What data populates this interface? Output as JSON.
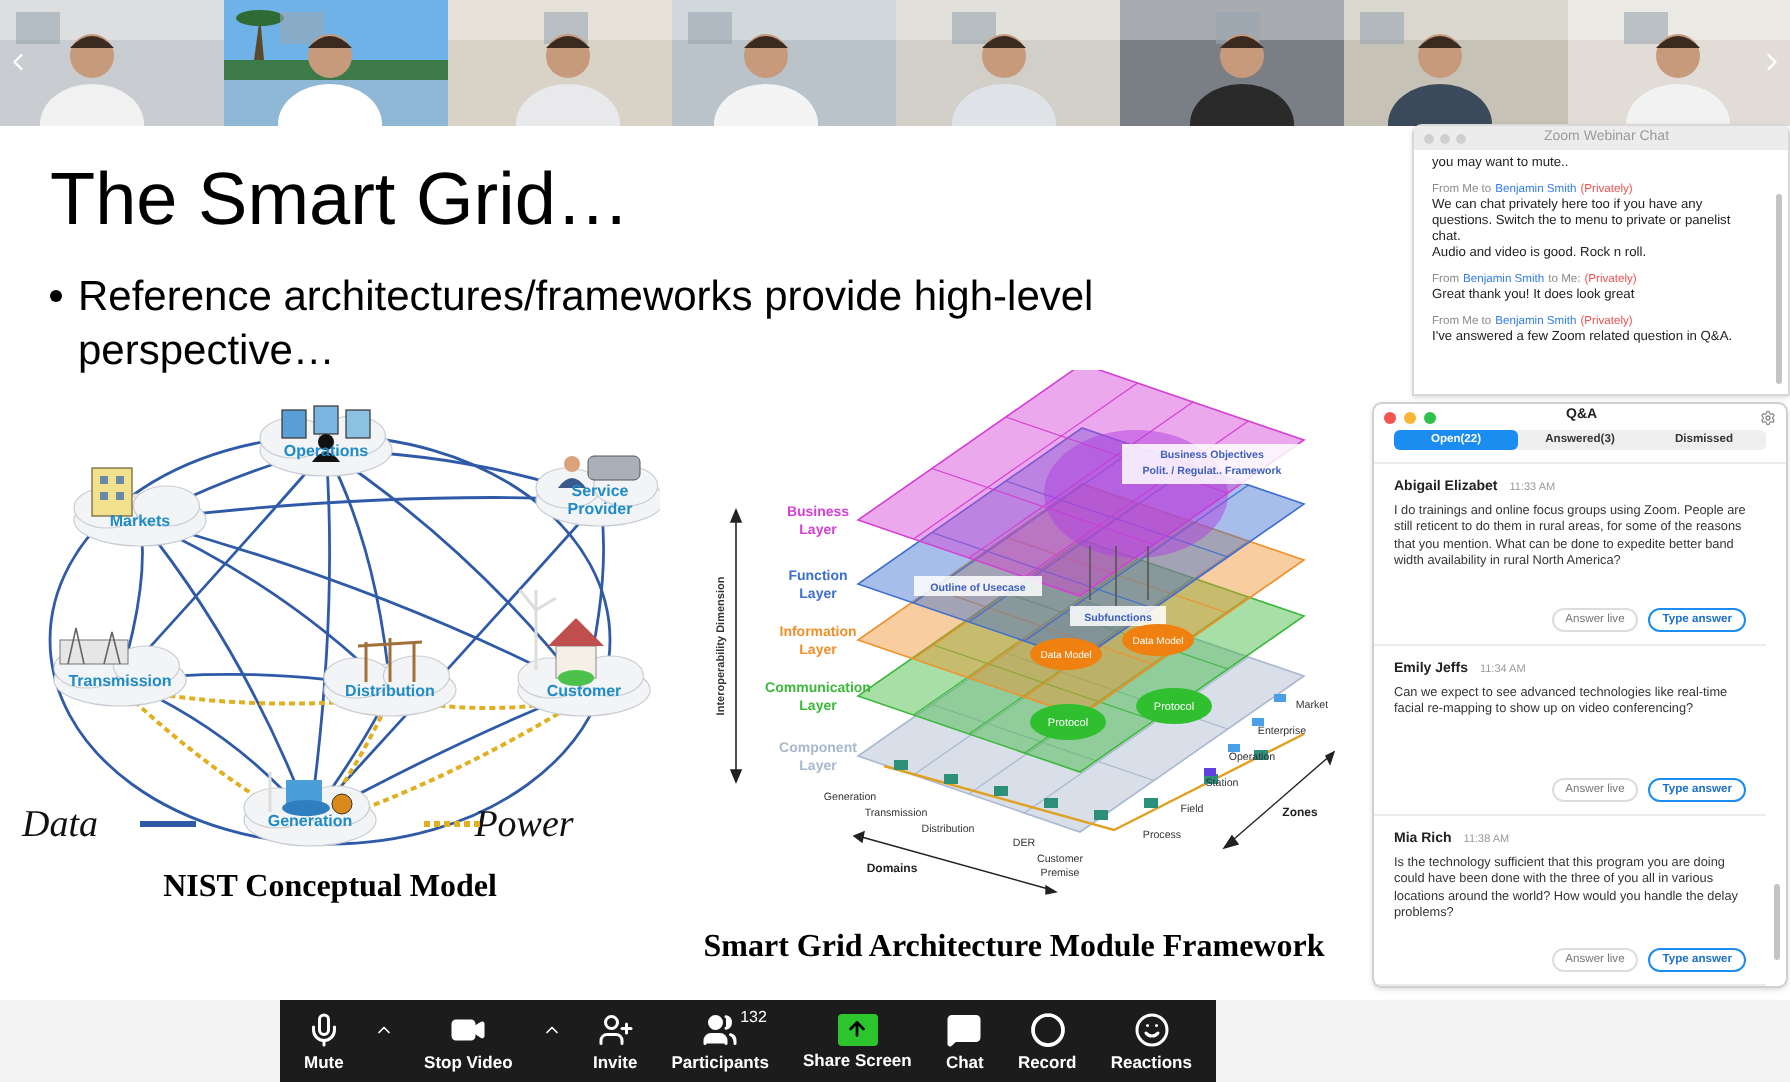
{
  "slide": {
    "title": "The Smart Grid…",
    "bullets": [
      "Reference architectures/frameworks provide high-level perspective…"
    ],
    "nist_diagram": {
      "nodes": [
        {
          "label": "Operations",
          "kind": "operations"
        },
        {
          "label": "Markets",
          "kind": "markets"
        },
        {
          "label": "Service Provider",
          "kind": "service"
        },
        {
          "label": "Transmission",
          "kind": "transmission"
        },
        {
          "label": "Distribution",
          "kind": "distribution"
        },
        {
          "label": "Customer",
          "kind": "customer"
        },
        {
          "label": "Generation",
          "kind": "generation"
        }
      ],
      "legend": [
        {
          "label": "Data",
          "kind": "data"
        },
        {
          "label": "Power",
          "kind": "power"
        }
      ],
      "caption": "NIST Conceptual Model"
    },
    "sgam_diagram": {
      "axis_label": "Interoperability Dimension",
      "layers": [
        {
          "label": "Business Layer",
          "color": "#d43fd4"
        },
        {
          "label": "Function Layer",
          "color": "#3d6fd0"
        },
        {
          "label": "Information Layer",
          "color": "#f0902a"
        },
        {
          "label": "Communication Layer",
          "color": "#3cb83c"
        },
        {
          "label": "Component Layer",
          "color": "#a9b8cf"
        }
      ],
      "objectives": [
        "Business Objectives",
        "Polit. / Regulat.. Framework"
      ],
      "usecase": "Outline of Usecase",
      "subfunctions": "Subfunctions",
      "data_models": [
        "Data Model",
        "Data Model"
      ],
      "protocols": [
        "Protocol",
        "Protocol"
      ],
      "zones": [
        "Market",
        "Enterprise",
        "Operation",
        "Station",
        "Field",
        "Process"
      ],
      "zones_label": "Zones",
      "domains": [
        "Generation",
        "Transmission",
        "Distribution",
        "DER",
        "Customer Premise"
      ],
      "domains_label": "Domains",
      "caption": "Smart Grid Architecture Module Framework"
    }
  },
  "chat": {
    "title": "Zoom Webinar Chat",
    "messages": [
      {
        "lines": [
          "you may want to mute.."
        ]
      },
      {
        "prefix": "From Me to",
        "name": "Benjamin Smith",
        "privacy": "(Privately)",
        "lines": [
          "We can chat privately here too if you have any questions. Switch the to menu to private or panelist chat.",
          "Audio and video is good. Rock n roll."
        ]
      },
      {
        "prefix": "From",
        "name": "Benjamin Smith",
        "suffix": "to Me:",
        "privacy": "(Privately)",
        "lines": [
          "Great thank you! It does look great"
        ]
      },
      {
        "prefix": "From Me to",
        "name": "Benjamin Smith",
        "privacy": "(Privately)",
        "lines": [
          "I've answered a few Zoom related question in Q&A."
        ]
      }
    ]
  },
  "qa": {
    "title": "Q&A",
    "tabs": [
      {
        "label": "Open(22)",
        "selected": true
      },
      {
        "label": "Answered(3)",
        "selected": false
      },
      {
        "label": "Dismissed",
        "selected": false
      }
    ],
    "questions": [
      {
        "author": "Abigail Elizabet",
        "time": "11:33 AM",
        "text": "I do trainings and online focus groups using Zoom. People are still reticent to do them in rural areas, for some of the reasons that you mention. What can be done to expedite better band width availability in rural North America?",
        "actions": [
          "Answer live",
          "Type answer"
        ]
      },
      {
        "author": "Emily Jeffs",
        "time": "11:34 AM",
        "text": "Can we expect to see advanced technologies like real-time facial re-mapping to show up on video conferencing?",
        "actions": [
          "Answer live",
          "Type answer"
        ]
      },
      {
        "author": "Mia Rich",
        "time": "11:38 AM",
        "text": "Is the technology sufficient that this program you are doing could have been done with the three of you all in various locations around the world?  How would you handle the delay problems?",
        "actions": [
          "Answer live",
          "Type answer"
        ]
      }
    ]
  },
  "toolbar": [
    {
      "label": "Mute",
      "kind": "mic",
      "caret": true
    },
    {
      "label": "Stop Video",
      "kind": "video",
      "caret": true
    },
    {
      "label": "Invite",
      "kind": "invite",
      "caret": false
    },
    {
      "label": "Participants",
      "kind": "participants",
      "count": "132",
      "caret": false
    },
    {
      "label": "Share Screen",
      "kind": "share",
      "caret": false
    },
    {
      "label": "Chat",
      "kind": "chat",
      "caret": false
    },
    {
      "label": "Record",
      "kind": "record",
      "caret": false
    },
    {
      "label": "Reactions",
      "kind": "reactions",
      "caret": false
    }
  ]
}
